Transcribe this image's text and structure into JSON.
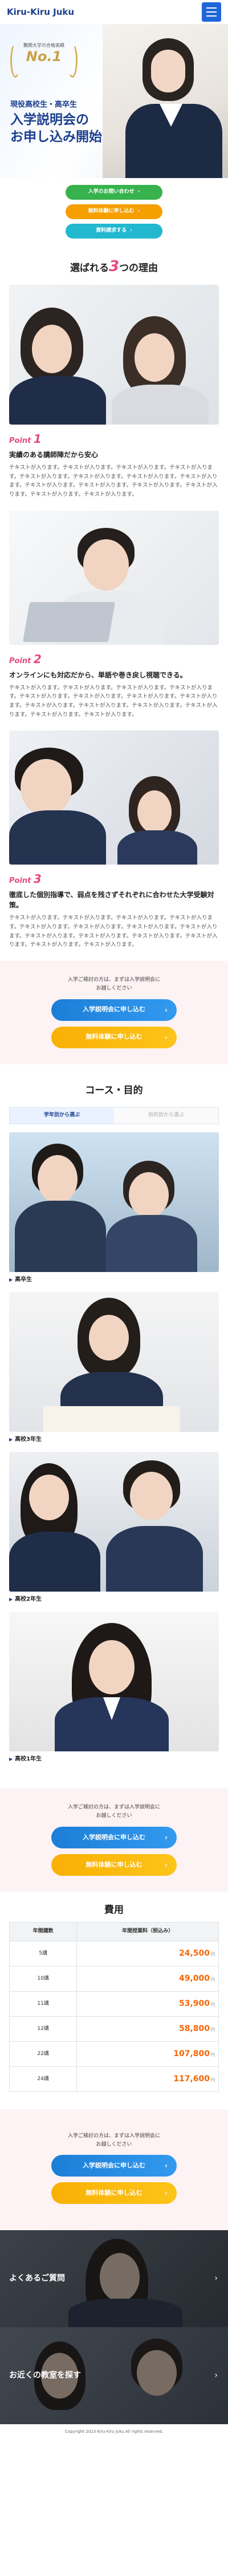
{
  "header": {
    "logo": "Kiru-Kiru Juku"
  },
  "hero": {
    "badge_sub": "難関大学の合格実績",
    "badge_main": "No.1",
    "kicker": "現役高校生・高卒生",
    "title_line1": "入学説明会の",
    "title_line2": "お申し込み開始",
    "buttons": [
      {
        "label": "入学のお問い合わせ",
        "color": "#37b24d"
      },
      {
        "label": "無料体験に申し込む",
        "color": "#f59f00"
      },
      {
        "label": "資料請求する",
        "color": "#22b8cf"
      }
    ]
  },
  "reasons": {
    "title_pre": "選ばれる",
    "title_num": "3",
    "title_post": "つの理由",
    "items": [
      {
        "point": "Point",
        "num": "1",
        "heading": "実績のある講師陣だから安心",
        "body": "テキストが入ります。テキストが入ります。テキストが入ります。テキストが入ります。テキストが入ります。テキストが入ります。テキストが入ります。テキストが入ります。テキストが入ります。テキストが入ります。テキストが入ります。テキストが入ります。テキストが入ります。テキストが入ります。"
      },
      {
        "point": "Point",
        "num": "2",
        "heading": "オンラインにも対応だから、単語や巻き戻し視聴できる。",
        "body": "テキストが入ります。テキストが入ります。テキストが入ります。テキストが入ります。テキストが入ります。テキストが入ります。テキストが入ります。テキストが入ります。テキストが入ります。テキストが入ります。テキストが入ります。テキストが入ります。テキストが入ります。テキストが入ります。"
      },
      {
        "point": "Point",
        "num": "3",
        "heading": "徹底した個別指導で、弱点を残さずそれぞれに合わせた大学受験対策。",
        "body": "テキストが入ります。テキストが入ります。テキストが入ります。テキストが入ります。テキストが入ります。テキストが入ります。テキストが入ります。テキストが入ります。テキストが入ります。テキストが入ります。テキストが入ります。テキストが入ります。テキストが入ります。テキストが入ります。"
      }
    ]
  },
  "cta": {
    "note_line1": "入学ご検討の方は、まずは入学説明会に",
    "note_line2": "お越しください",
    "primary": "入学説明会に申し込む",
    "secondary": "無料体験に申し込む",
    "colors": {
      "primary": "#1c7ed6",
      "secondary": "#fab005"
    }
  },
  "courses": {
    "title": "コース・目的",
    "tabs": [
      "学年別から選ぶ",
      "目的別から選ぶ"
    ],
    "items": [
      "高卒生",
      "高校3年生",
      "高校2年生",
      "高校1年生"
    ]
  },
  "fees": {
    "title": "費用",
    "col_times": "年間講数",
    "col_price": "年間授業料（税込み）",
    "unit": "円",
    "rows": [
      {
        "times": "5講",
        "price": "24,500"
      },
      {
        "times": "10講",
        "price": "49,000"
      },
      {
        "times": "11講",
        "price": "53,900"
      },
      {
        "times": "12講",
        "price": "58,800"
      },
      {
        "times": "22講",
        "price": "107,800"
      },
      {
        "times": "24講",
        "price": "117,600"
      }
    ]
  },
  "links": [
    {
      "label": "よくあるご質問"
    },
    {
      "label": "お近くの教室を探す"
    }
  ],
  "footer": {
    "copyright": "Copyright 2023 Kiru-Kiru Juku All rights reserved."
  }
}
